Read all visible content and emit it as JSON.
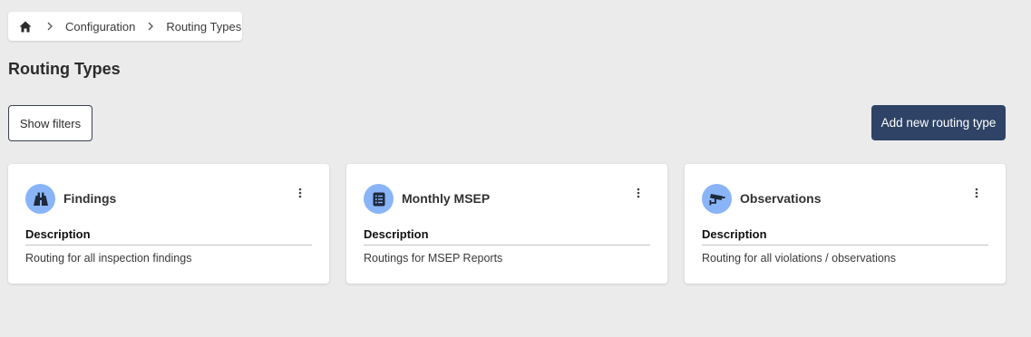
{
  "breadcrumb": {
    "home_icon": "home-icon",
    "items": [
      "Configuration",
      "Routing Types"
    ]
  },
  "page": {
    "title": "Routing Types"
  },
  "toolbar": {
    "show_filters_label": "Show filters",
    "add_label": "Add new routing type"
  },
  "colors": {
    "background": "#ebebeb",
    "primary_button": "#2e4366",
    "icon_circle": "#8ab4f8",
    "icon_glyph": "#1f2a3c"
  },
  "cards": [
    {
      "title": "Findings",
      "icon": "binoculars-icon",
      "description_label": "Description",
      "description": "Routing for all inspection findings"
    },
    {
      "title": "Monthly MSEP",
      "icon": "list-icon",
      "description_label": "Description",
      "description": "Routings for MSEP Reports"
    },
    {
      "title": "Observations",
      "icon": "security-camera-icon",
      "description_label": "Description",
      "description": "Routing for all violations / observations"
    }
  ]
}
